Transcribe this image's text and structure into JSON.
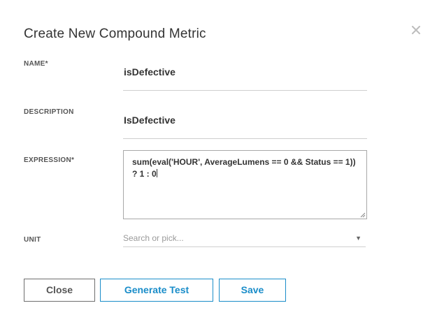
{
  "dialog": {
    "title": "Create New Compound Metric",
    "close_icon": "close-icon"
  },
  "form": {
    "name": {
      "label": "NAME*",
      "value": "isDefective"
    },
    "description": {
      "label": "DESCRIPTION",
      "value": "IsDefective"
    },
    "expression": {
      "label": "EXPRESSION*",
      "value": "sum(eval('HOUR', AverageLumens == 0 && Status == 1)) ? 1 : 0"
    },
    "unit": {
      "label": "UNIT",
      "placeholder": "Search or pick...",
      "arrow": "▼"
    }
  },
  "buttons": {
    "close_label": "Close",
    "generate_test_label": "Generate Test",
    "save_label": "Save"
  },
  "colors": {
    "accent": "#1a8dc9",
    "text": "#333333",
    "border": "#cfcfcf"
  }
}
